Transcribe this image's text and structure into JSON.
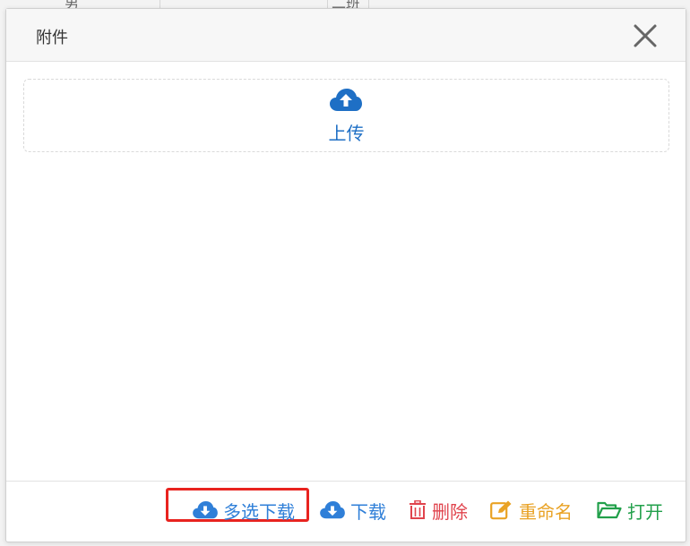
{
  "background": {
    "cells": [
      "男",
      "二班"
    ]
  },
  "dialog": {
    "title": "附件",
    "close_icon": "close-icon"
  },
  "upload": {
    "label": "上传",
    "icon": "cloud-upload-icon"
  },
  "footer": {
    "actions": [
      {
        "label": "多选下载",
        "icon": "cloud-download-icon",
        "color": "#2f7fd8"
      },
      {
        "label": "下载",
        "icon": "cloud-download-icon",
        "color": "#2f7fd8"
      },
      {
        "label": "删除",
        "icon": "trash-icon",
        "color": "#e0434c"
      },
      {
        "label": "重命名",
        "icon": "edit-icon",
        "color": "#e9a224"
      },
      {
        "label": "打开",
        "icon": "folder-open-icon",
        "color": "#22a04b"
      }
    ]
  },
  "colors": {
    "highlight": "#e8231f",
    "upload_accent": "#1e6fc5"
  }
}
